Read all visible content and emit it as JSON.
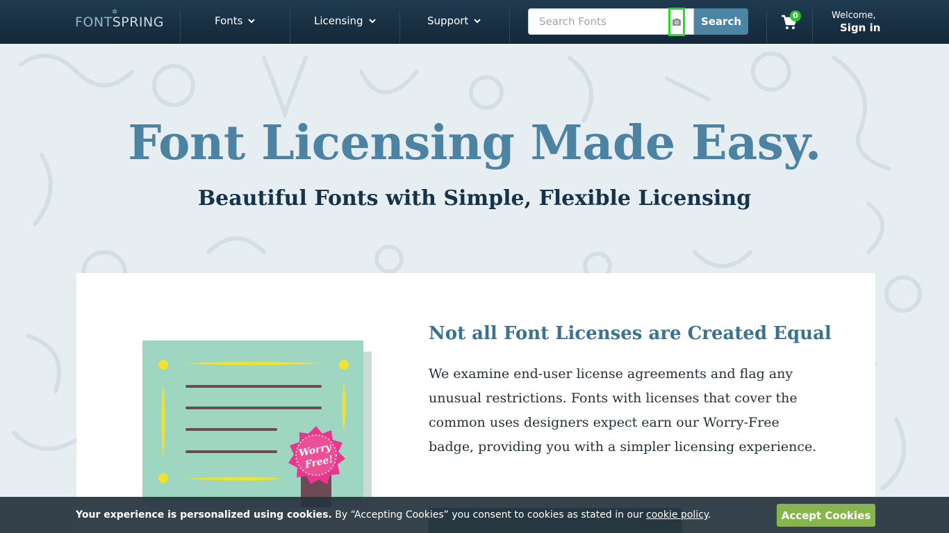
{
  "header": {
    "logo_part1": "FONT",
    "logo_part2": "SPRING",
    "nav": [
      {
        "label": "Fonts"
      },
      {
        "label": "Licensing"
      },
      {
        "label": "Support"
      }
    ],
    "search": {
      "placeholder": "Search Fonts",
      "value": "",
      "button_label": "Search"
    },
    "cart_count": "0",
    "welcome": "Welcome,",
    "signin": "Sign in"
  },
  "hero": {
    "title": "Font Licensing Made Easy.",
    "subtitle": "Beautiful Fonts with Simple, Flexible Licensing"
  },
  "section": {
    "title": "Not all Font Licenses are Created Equal",
    "body": "We examine end-user license agreements and flag any unusual restrictions. Fonts with licenses that cover the common uses designers expect earn our Worry-Free badge, providing you with a simpler licensing experience.",
    "badge_line1": "Worry",
    "badge_line2": "Free!"
  },
  "cookie": {
    "bold_text": "Your experience is personalized using cookies.",
    "text": " By “Accepting Cookies” you consent to cookies as stated in our ",
    "link": "cookie policy",
    "end": ".",
    "button": "Accept Cookies"
  },
  "colors": {
    "header_bg": "#1b3447",
    "accent": "#4c83a3",
    "cookie_button": "#86b54c",
    "cart_badge": "#28c828"
  }
}
